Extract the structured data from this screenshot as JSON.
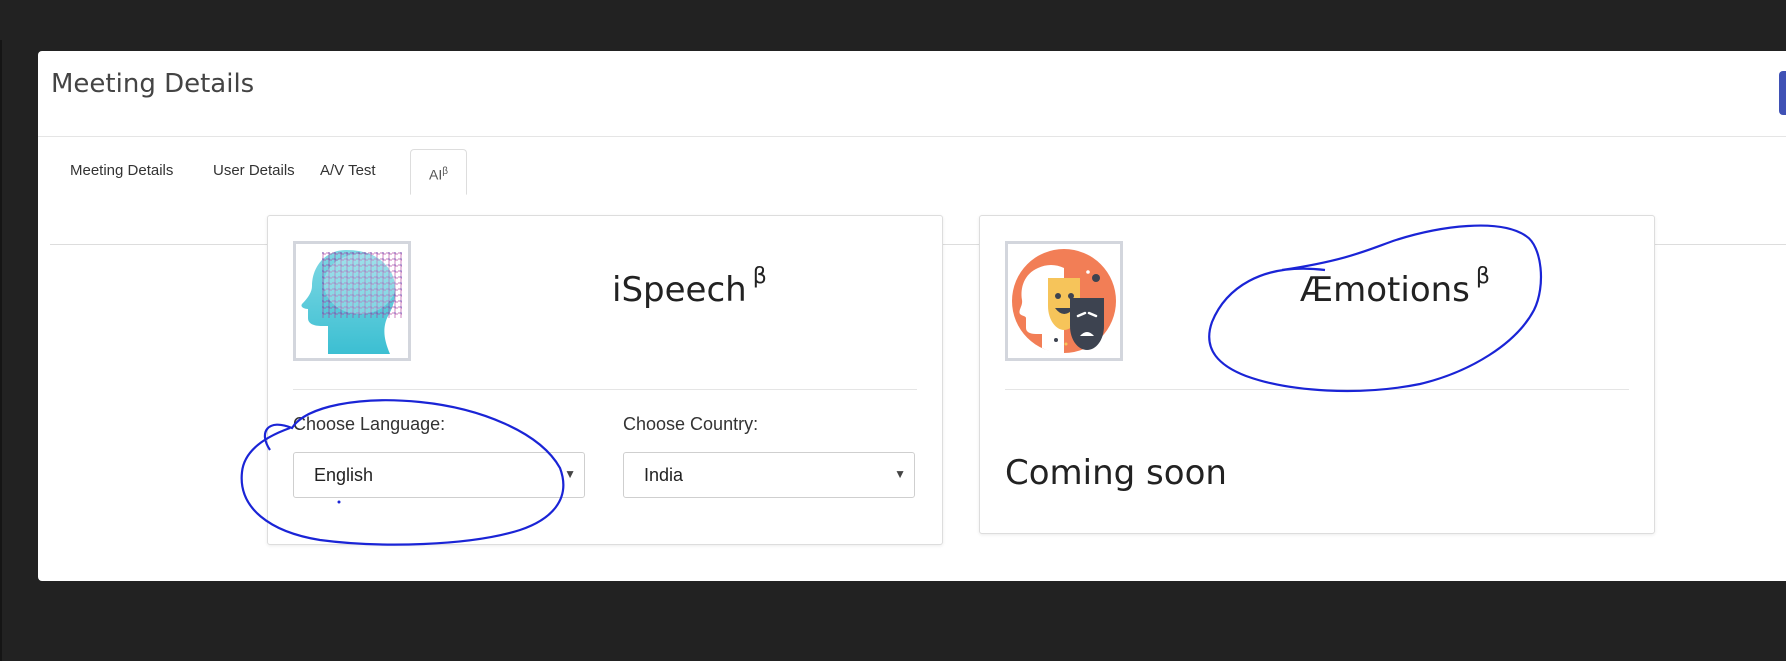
{
  "modal": {
    "title": "Meeting Details"
  },
  "tabs": [
    {
      "label": "Meeting Details",
      "active": false
    },
    {
      "label": "User Details",
      "active": false
    },
    {
      "label": "A/V Test",
      "active": false
    },
    {
      "label": "AI",
      "sup": "β",
      "active": true
    }
  ],
  "ispeech": {
    "title": "iSpeech",
    "beta": "β",
    "language_label": "Choose Language:",
    "language_value": "English",
    "country_label": "Choose Country:",
    "country_value": "India"
  },
  "emotions": {
    "title": "Æmotions",
    "beta": "β",
    "status": "Coming soon"
  },
  "colors": {
    "background": "#222222",
    "head_cyan": "#4cc6d6",
    "emotions_orange": "#f27e56",
    "mask_yellow": "#f6c45a",
    "mask_dark": "#3d4350",
    "annotation_blue": "#1a24d6",
    "accent_button": "#3f51b5"
  }
}
